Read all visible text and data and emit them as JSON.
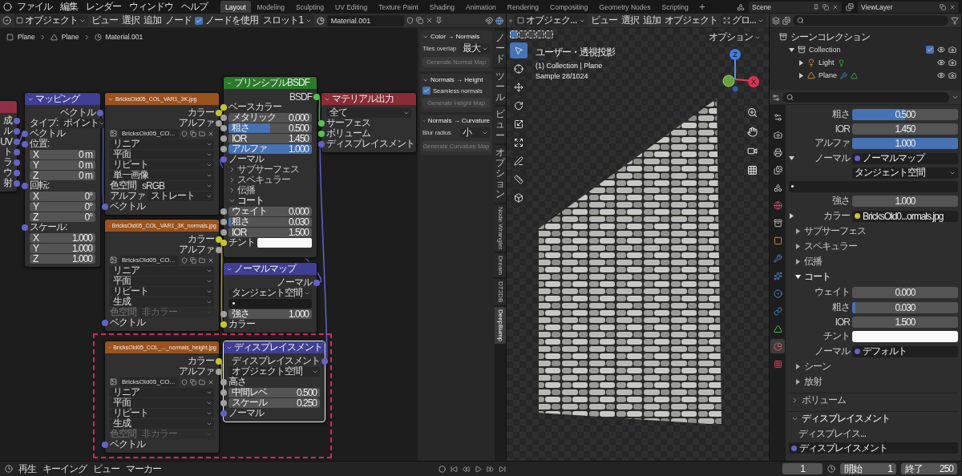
{
  "topbar": {
    "menus": [
      "ファイル",
      "編集",
      "レンダー",
      "ウィンドウ",
      "ヘルプ"
    ],
    "workspaces": [
      {
        "label": "Layout",
        "selected": true
      },
      {
        "label": "Modeling",
        "selected": false
      },
      {
        "label": "Sculpting",
        "selected": false
      },
      {
        "label": "UV Editing",
        "selected": false
      },
      {
        "label": "Texture Paint",
        "selected": false
      },
      {
        "label": "Shading",
        "selected": false
      },
      {
        "label": "Animation",
        "selected": false
      },
      {
        "label": "Rendering",
        "selected": false
      },
      {
        "label": "Compositing",
        "selected": false
      },
      {
        "label": "Geometry Nodes",
        "selected": false
      },
      {
        "label": "Scripting",
        "selected": false
      }
    ],
    "add_tab": "+",
    "scene": "Scene",
    "view_layer": "ViewLayer"
  },
  "node_editor": {
    "header": {
      "mode": "オブジェクト",
      "menus": [
        "ビュー",
        "選択",
        "追加",
        "ノード"
      ],
      "use_nodes": {
        "label": "ノードを使用",
        "checked": true
      },
      "slot": "スロット1",
      "material": "Material.001"
    },
    "breadcrumb": [
      "Plane",
      "Plane",
      "Material.001"
    ],
    "highlight_frame": true,
    "nodes": [
      {
        "kind": "texture_coordinate",
        "selected": false,
        "rows": [
          {
            "kind": "output",
            "label": "成",
            "color": "#6363c7"
          },
          {
            "kind": "output",
            "label": "ル",
            "color": "#6363c7"
          },
          {
            "kind": "output",
            "label": "UV",
            "color": "#6363c7"
          },
          {
            "kind": "output",
            "label": "ト",
            "color": "#6363c7"
          },
          {
            "kind": "output",
            "label": "ラ",
            "color": "#6363c7"
          },
          {
            "kind": "output",
            "label": "ウ",
            "color": "#6363c7"
          },
          {
            "kind": "output",
            "label": "射",
            "color": "#6363c7"
          }
        ]
      },
      {
        "kind": "mapping",
        "title": "マッピング",
        "selected": false,
        "rows": [
          {
            "kind": "output",
            "label": "ベクトル",
            "color": "#6363c7"
          },
          {
            "kind": "dropdown",
            "label": "タイプ:",
            "value": "ポイント"
          },
          {
            "kind": "input",
            "label": "ベクトル",
            "color": "#6363c7"
          },
          {
            "kind": "input",
            "label": "位置:",
            "color": "#6363c7"
          },
          {
            "kind": "field",
            "label": "X",
            "value": "0 m"
          },
          {
            "kind": "field",
            "label": "Y",
            "value": "0 m"
          },
          {
            "kind": "field",
            "label": "Z",
            "value": "0 m"
          },
          {
            "kind": "input",
            "label": "回転:",
            "color": "#6363c7"
          },
          {
            "kind": "field",
            "label": "X",
            "value": "0°"
          },
          {
            "kind": "field",
            "label": "Y",
            "value": "0°"
          },
          {
            "kind": "field",
            "label": "Z",
            "value": "0°"
          },
          {
            "kind": "input",
            "label": "スケール:",
            "color": "#6363c7"
          },
          {
            "kind": "field",
            "label": "X",
            "value": "1.000"
          },
          {
            "kind": "field",
            "label": "Y",
            "value": "1.000"
          },
          {
            "kind": "field",
            "label": "Z",
            "value": "1.000"
          }
        ]
      },
      {
        "kind": "image_texture",
        "title": "BricksOld05_COL_VAR1_3K.jpg",
        "selected": false,
        "rows": [
          {
            "kind": "output",
            "label": "カラー",
            "color": "#c7c729"
          },
          {
            "kind": "output",
            "label": "アルファ",
            "color": "#a1a1a1"
          },
          {
            "kind": "image",
            "value": "BricksOld05_CO..."
          },
          {
            "kind": "dropdown",
            "value": "リニア"
          },
          {
            "kind": "dropdown",
            "value": "平面"
          },
          {
            "kind": "dropdown",
            "value": "リピート"
          },
          {
            "kind": "dropdown",
            "value": "単一画像"
          },
          {
            "kind": "dropdown",
            "label": "色空間",
            "value": "sRGB"
          },
          {
            "kind": "dropdown",
            "label": "アルファ",
            "value": "ストレート"
          },
          {
            "kind": "input",
            "label": "ベクトル",
            "color": "#6363c7"
          }
        ]
      },
      {
        "kind": "principled",
        "title": "プリンシプルBSDF",
        "selected": false,
        "rows": [
          {
            "kind": "output",
            "label": "BSDF",
            "color": "#4fc74f"
          },
          {
            "kind": "input",
            "label": "ベースカラー",
            "color": "#c7c729"
          },
          {
            "kind": "field",
            "label": "メタリック",
            "value": "0.000",
            "color": "#a1a1a1"
          },
          {
            "kind": "field",
            "label": "粗さ",
            "value": "0.500",
            "color": "#a1a1a1",
            "level": 0.5
          },
          {
            "kind": "field",
            "label": "IOR",
            "value": "1.450",
            "color": "#a1a1a1"
          },
          {
            "kind": "field",
            "label": "アルファ",
            "value": "1.000",
            "color": "#a1a1a1",
            "level": 1
          },
          {
            "kind": "input",
            "label": "ノーマル",
            "color": "#6363c7"
          },
          {
            "kind": "panel",
            "label": "サブサーフェス",
            "expanded": false
          },
          {
            "kind": "panel",
            "label": "スペキュラー",
            "expanded": false
          },
          {
            "kind": "panel",
            "label": "伝播",
            "expanded": false
          },
          {
            "kind": "panel",
            "label": "コート",
            "expanded": true
          },
          {
            "kind": "field",
            "label": "ウェイト",
            "value": "0.000",
            "color": "#a1a1a1"
          },
          {
            "kind": "field",
            "label": "粗さ",
            "value": "0.030",
            "color": "#a1a1a1",
            "level": 0.03
          },
          {
            "kind": "field",
            "label": "IOR",
            "value": "1.500",
            "color": "#a1a1a1"
          },
          {
            "kind": "swatch",
            "label": "チント",
            "color": "#c7c729"
          }
        ]
      },
      {
        "kind": "material_output",
        "title": "マテリアル出力",
        "selected": false,
        "rows": [
          {
            "kind": "dropdown",
            "value": "全て"
          },
          {
            "kind": "input",
            "label": "サーフェス",
            "color": "#4fc74f"
          },
          {
            "kind": "input",
            "label": "ボリューム",
            "color": "#4fc74f"
          },
          {
            "kind": "input",
            "label": "ディスプレイスメント",
            "color": "#6363c7"
          }
        ]
      },
      {
        "kind": "image_texture",
        "title": "BricksOld05_COL_VAR1_3K_normals.jpg",
        "selected": false,
        "rows": [
          {
            "kind": "output",
            "label": "カラー",
            "color": "#c7c729"
          },
          {
            "kind": "output",
            "label": "アルファ",
            "color": "#a1a1a1"
          },
          {
            "kind": "image",
            "value": "BricksOld05_CO..."
          },
          {
            "kind": "dropdown",
            "value": "リニア"
          },
          {
            "kind": "dropdown",
            "value": "平面"
          },
          {
            "kind": "dropdown",
            "value": "リピート"
          },
          {
            "kind": "dropdown",
            "value": "生成"
          },
          {
            "kind": "dropdown",
            "label": "色空間",
            "value": "非カラー",
            "disabled": true
          },
          {
            "kind": "input",
            "label": "ベクトル",
            "color": "#6363c7"
          }
        ]
      },
      {
        "kind": "normal_map",
        "title": "ノーマルマップ",
        "selected": false,
        "rows": [
          {
            "kind": "output",
            "label": "ノーマル",
            "color": "#6363c7"
          },
          {
            "kind": "dropdown",
            "value": "タンジェント空間"
          },
          {
            "kind": "uvfield"
          },
          {
            "kind": "field",
            "label": "強さ",
            "value": "1.000",
            "color": "#a1a1a1"
          },
          {
            "kind": "input",
            "label": "カラー",
            "color": "#c7c729"
          }
        ]
      },
      {
        "kind": "image_texture",
        "title": "BricksOld05_COL_..._normals_height.jpg",
        "selected": false,
        "rows": [
          {
            "kind": "output",
            "label": "カラー",
            "color": "#c7c729"
          },
          {
            "kind": "output",
            "label": "アルファ",
            "color": "#a1a1a1"
          },
          {
            "kind": "image",
            "value": "BricksOld05_CO..."
          },
          {
            "kind": "dropdown",
            "value": "リニア"
          },
          {
            "kind": "dropdown",
            "value": "平面"
          },
          {
            "kind": "dropdown",
            "value": "リピート"
          },
          {
            "kind": "dropdown",
            "value": "生成"
          },
          {
            "kind": "dropdown",
            "label": "色空間",
            "value": "非カラー",
            "disabled": true
          },
          {
            "kind": "input",
            "label": "ベクトル",
            "color": "#6363c7"
          }
        ]
      },
      {
        "kind": "displacement",
        "title": "ディスプレイスメント",
        "selected": true,
        "rows": [
          {
            "kind": "output",
            "label": "ディスプレイスメント",
            "color": "#6363c7"
          },
          {
            "kind": "dropdown",
            "value": "オブジェクト空間"
          },
          {
            "kind": "input",
            "label": "高さ",
            "color": "#a1a1a1"
          },
          {
            "kind": "field",
            "label": "中間レベ",
            "value": "0.500",
            "color": "#a1a1a1"
          },
          {
            "kind": "field",
            "label": "スケール",
            "value": "0.250",
            "color": "#a1a1a1"
          },
          {
            "kind": "input",
            "label": "ノーマル",
            "color": "#6363c7"
          }
        ]
      }
    ],
    "sidebar": {
      "panels": [
        {
          "title": "Color → Normals",
          "expanded": true,
          "rows": [
            {
              "kind": "dropdown",
              "label": "Tiles overlap",
              "value": "最大"
            },
            {
              "kind": "button",
              "label": "Generate Normal Map"
            }
          ]
        },
        {
          "title": "Normals → Height",
          "expanded": true,
          "rows": [
            {
              "kind": "checkbox",
              "label": "Seamless normals",
              "checked": true
            },
            {
              "kind": "button",
              "label": "Generate Height Map"
            }
          ]
        },
        {
          "title": "Normals → Curvature",
          "expanded": true,
          "rows": [
            {
              "kind": "dropdown",
              "label": "Blur radius",
              "value": "小"
            },
            {
              "kind": "button",
              "label": "Generate Curvature Map"
            }
          ]
        }
      ]
    },
    "sidebar_tabs": [
      {
        "label": "ノード",
        "kind": "stacked",
        "selected": false
      },
      {
        "label": "ツール",
        "kind": "stacked",
        "selected": false
      },
      {
        "label": "ビュー",
        "kind": "stacked",
        "selected": false
      },
      {
        "label": "オプション",
        "kind": "stacked",
        "selected": false
      },
      {
        "label": "Node Wrangler",
        "kind": "rotated",
        "selected": false
      },
      {
        "label": "Dream",
        "kind": "rotated",
        "selected": false
      },
      {
        "label": "DT2DB",
        "kind": "rotated",
        "selected": false
      },
      {
        "label": "DeepBump",
        "kind": "rotated",
        "selected": true
      }
    ]
  },
  "viewport": {
    "header": {
      "mode": "オブジェク...",
      "menus": [
        "ビュー",
        "選択",
        "追加",
        "オブジェクト"
      ],
      "orientation": "グロ..."
    },
    "options": "オプション",
    "overlay": [
      "ユーザー・透視投影",
      "(1) Collection | Plane",
      "Sample 28/1024"
    ],
    "gizmo": {
      "z": "Z",
      "x": "X"
    },
    "tools": [
      {
        "kind": "select",
        "selected": true
      },
      {
        "kind": "cursor",
        "selected": false
      },
      {
        "kind": "move",
        "selected": false
      },
      {
        "kind": "rotate",
        "selected": false
      },
      {
        "kind": "scale",
        "selected": false
      },
      {
        "kind": "transform",
        "selected": false
      },
      {
        "kind": "annotate",
        "selected": false
      },
      {
        "kind": "measure",
        "selected": false
      },
      {
        "kind": "add",
        "selected": false
      }
    ]
  },
  "outliner": {
    "root": "シーンコレクション",
    "items": [
      {
        "kind": "collection",
        "label": "Collection",
        "checked": true,
        "expanded": true,
        "children": [
          {
            "kind": "light",
            "label": "Light",
            "expanded": false
          },
          {
            "kind": "mesh",
            "label": "Plane",
            "expanded": false
          }
        ]
      }
    ]
  },
  "properties": {
    "tabs": [
      {
        "kind": "tool",
        "selected": false
      },
      {
        "kind": "render",
        "selected": false
      },
      {
        "kind": "output",
        "selected": false
      },
      {
        "kind": "view_layer",
        "selected": false
      },
      {
        "kind": "scene",
        "selected": false
      },
      {
        "kind": "world",
        "selected": false
      },
      {
        "kind": "collection",
        "selected": false
      },
      {
        "kind": "object",
        "selected": false
      },
      {
        "kind": "modifier",
        "selected": false
      },
      {
        "kind": "particles",
        "selected": false
      },
      {
        "kind": "physics",
        "selected": false
      },
      {
        "kind": "constraints",
        "selected": false
      },
      {
        "kind": "data",
        "selected": false
      },
      {
        "kind": "material",
        "selected": true
      },
      {
        "kind": "texture",
        "selected": false
      }
    ],
    "rows": [
      {
        "kind": "field",
        "label": "粗さ",
        "value": "0.500",
        "level": 0.5
      },
      {
        "kind": "field",
        "label": "IOR",
        "value": "1.450"
      },
      {
        "kind": "field",
        "label": "アルファ",
        "value": "1.000",
        "level": 1
      },
      {
        "kind": "link",
        "label": "ノーマル",
        "value": "ノーマルマップ",
        "color": "#6363c7",
        "expanded": true
      },
      {
        "kind": "dropdown",
        "value": "タンジェント空間"
      },
      {
        "kind": "uvfield"
      },
      {
        "kind": "field",
        "label": "強さ",
        "value": "1.000"
      },
      {
        "kind": "link",
        "label": "カラー",
        "value": "BricksOld0...ormals.jpg",
        "color": "#c7c729",
        "expanded": false
      },
      {
        "kind": "panel",
        "label": "サブサーフェス",
        "expanded": false
      },
      {
        "kind": "panel",
        "label": "スペキュラー",
        "expanded": false
      },
      {
        "kind": "panel",
        "label": "伝播",
        "expanded": false
      },
      {
        "kind": "panel",
        "label": "コート",
        "expanded": true
      },
      {
        "kind": "field",
        "label": "ウェイト",
        "value": "0.000"
      },
      {
        "kind": "field",
        "label": "粗さ",
        "value": "0.030",
        "level": 0.03
      },
      {
        "kind": "field",
        "label": "IOR",
        "value": "1.500"
      },
      {
        "kind": "swatch",
        "label": "チント"
      },
      {
        "kind": "link",
        "label": "ノーマル",
        "value": "デフォルト",
        "color": "#6363c7"
      },
      {
        "kind": "panel",
        "label": "シーン",
        "expanded": false
      },
      {
        "kind": "panel",
        "label": "放射",
        "expanded": false
      }
    ],
    "sections": [
      {
        "title": "ボリューム",
        "expanded": false
      },
      {
        "title": "ディスプレイスメント",
        "expanded": true,
        "rows": [
          {
            "kind": "link",
            "label": "ディスプレイス...",
            "value": "ディスプレイスメント",
            "color": "#6363c7"
          }
        ]
      }
    ]
  },
  "timeline": {
    "menus": [
      "再生",
      "キーイング",
      "ビュー",
      "マーカー"
    ],
    "current_frame": "1",
    "start_label": "開始",
    "start": "1",
    "end_label": "終了",
    "end": "250"
  }
}
